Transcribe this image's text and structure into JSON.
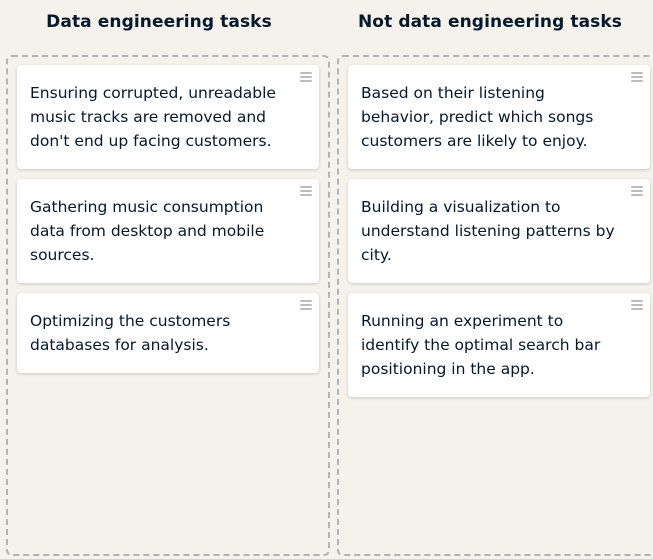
{
  "columns": [
    {
      "title": "Data engineering tasks",
      "cards": [
        {
          "text": "Ensuring corrupted, unreadable music tracks are removed and don't end up facing customers."
        },
        {
          "text": "Gathering music consumption data from desktop and mobile sources."
        },
        {
          "text": "Optimizing the customers databases for analysis."
        }
      ]
    },
    {
      "title": "Not data engineering tasks",
      "cards": [
        {
          "text": "Based on their listening behavior, predict which songs customers are likely to enjoy."
        },
        {
          "text": "Building a visualization to understand listening patterns by city."
        },
        {
          "text": "Running an experiment to identify the optimal search bar positioning in the app."
        }
      ]
    }
  ],
  "icons": {
    "card_handle": "drag-handle-icon"
  },
  "colors": {
    "background": "#f5f1eb",
    "text": "#05192d",
    "card": "#ffffff",
    "dashed_border": "#b3b3b3",
    "handle": "#bcbcbc"
  }
}
